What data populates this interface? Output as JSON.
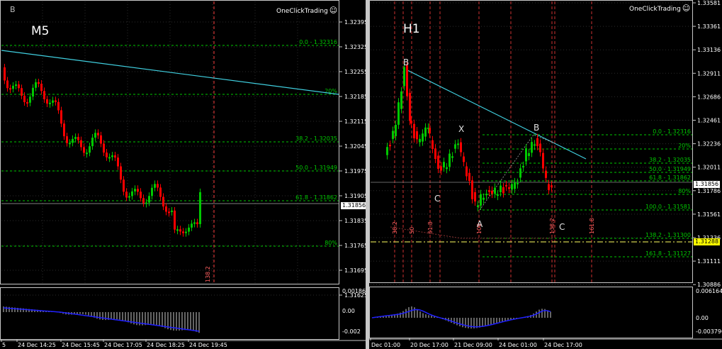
{
  "colors": {
    "background": "#000000",
    "grid": "#2c2c2c",
    "axis": "#c8c8c8",
    "bull": "#00c800",
    "bear": "#ff0000",
    "fib": "#00c800",
    "trend": "#40d0e0",
    "vline": "#ff4040",
    "histogram": "#c8c8c8",
    "signal": "#2020ff"
  },
  "left_chart": {
    "timeframe": "M5",
    "marker": "B",
    "one_click_label": "OneClickTrading",
    "current_price": "1.31856",
    "price_labels": [
      "1.32395",
      "1.32325",
      "1.32255",
      "1.32185",
      "1.32115",
      "1.32045",
      "1.31975",
      "1.31905",
      "1.31835",
      "1.31765",
      "1.31695",
      "1.31625"
    ],
    "fib_labels": [
      "0.0 - 1.32316",
      "20%",
      "38.2 - 1.32035",
      "50.0 - 1.31949",
      "61.8 - 1.31862",
      "80%"
    ],
    "vline_label": "138.2",
    "osc_labels": [
      "0.001862",
      "0.00",
      "-0.002"
    ],
    "time_labels": [
      "5",
      "24 Dec 14:25",
      "24 Dec 15:45",
      "24 Dec 17:05",
      "24 Dec 18:25",
      "24 Dec 19:45"
    ]
  },
  "right_chart": {
    "timeframe": "H1",
    "marker": "",
    "one_click_label": "OneClickTrading",
    "current_price": "1.31856",
    "highlight_price": "1.31288",
    "price_labels": [
      "1.33581",
      "1.33361",
      "1.33136",
      "1.32911",
      "1.32686",
      "1.32461",
      "1.32236",
      "1.32011",
      "1.31786",
      "1.31561",
      "1.31336",
      "1.31111",
      "1.30886"
    ],
    "fib_labels": [
      "0.0 - 1.32316",
      "20%",
      "38.2 - 1.32035",
      "50.0 - 1.31949",
      "61.8 - 1.31862",
      "80%",
      "100.0 - 1.31581",
      "138.2 - 1.31300",
      "161.8 - 1.31127"
    ],
    "wave_labels": [
      "B",
      "C",
      "X",
      "A",
      "B",
      "C"
    ],
    "vline_labels": [
      "38.2",
      "50",
      "61.8",
      "100",
      "138.2",
      "161.8"
    ],
    "osc_labels": [
      "0.006164",
      "0.00",
      "-0.003796"
    ],
    "time_labels": [
      "Dec 01:00",
      "20 Dec 17:00",
      "21 Dec 09:00",
      "24 Dec 01:00",
      "24 Dec 17:00"
    ]
  }
}
